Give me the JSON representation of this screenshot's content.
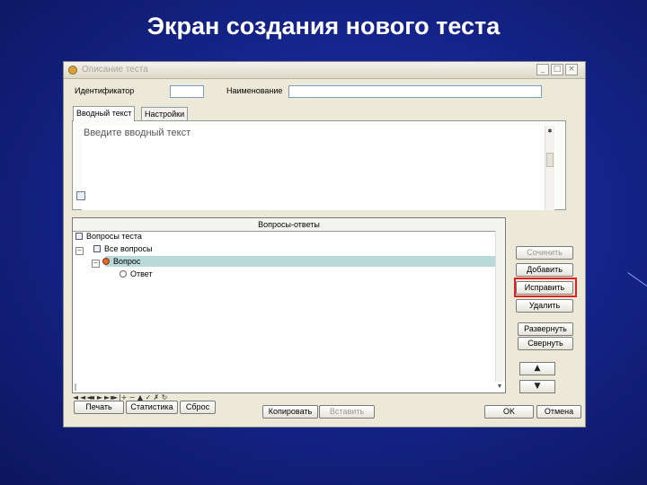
{
  "slide": {
    "title": "Экран создания нового теста"
  },
  "window": {
    "title": "Описание теста",
    "controls": {
      "minimize": "_",
      "maximize": "□",
      "close": "×"
    }
  },
  "fields": {
    "identifier_label": "Идентификатор",
    "identifier_value": "",
    "name_label": "Наименование",
    "name_value": ""
  },
  "tabs": [
    {
      "label": "Вводный текст",
      "active": true
    },
    {
      "label": "Настройки",
      "active": false
    }
  ],
  "intro": {
    "placeholder": "Введите вводный текст"
  },
  "qa": {
    "header": "Вопросы-ответы",
    "tree": [
      {
        "label": "Вопросы теста",
        "level": 0
      },
      {
        "label": "Все вопросы",
        "level": 1
      },
      {
        "label": "Вопрос",
        "level": 2,
        "selected": true
      },
      {
        "label": "Ответ",
        "level": 3
      }
    ]
  },
  "nav": [
    "|◄",
    "◄◄",
    "◄",
    "►",
    "►►",
    "►|",
    "+",
    "−",
    "▲",
    "✓",
    "✗",
    "↻"
  ],
  "side_buttons": {
    "compose": "Сочинить",
    "add": "Добавить",
    "edit": "Исправить",
    "delete": "Удалить",
    "expand": "Развернуть",
    "collapse": "Свернуть",
    "move_up": "▲",
    "move_down": "▼"
  },
  "bottom_buttons": {
    "print": "Печать",
    "stats": "Статистика",
    "reset": "Сброс",
    "copy": "Копировать",
    "paste": "Вставить",
    "ok": "OK",
    "cancel": "Отмена"
  },
  "colors": {
    "highlight_border": "#e02020",
    "selection": "#b9d9db"
  }
}
